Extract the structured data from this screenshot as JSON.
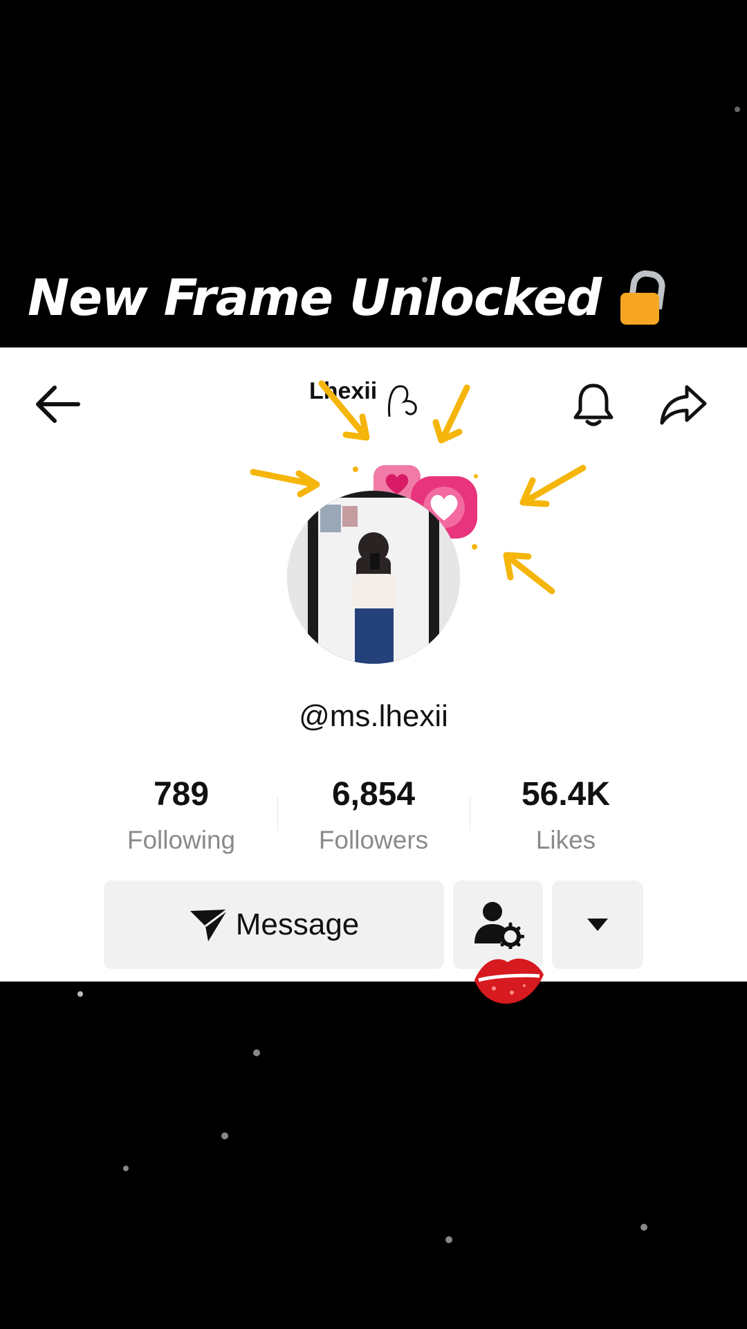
{
  "caption": {
    "text": "New Frame Unlocked"
  },
  "header": {
    "title": "Lhexii"
  },
  "profile": {
    "username": "@ms.lhexii"
  },
  "stats": [
    {
      "value": "789",
      "label": "Following"
    },
    {
      "value": "6,854",
      "label": "Followers"
    },
    {
      "value": "56.4K",
      "label": "Likes"
    }
  ],
  "actions": {
    "message_label": "Message"
  },
  "colors": {
    "background": "#000000",
    "card": "#ffffff",
    "button": "#f1f1f2",
    "accent_arrow": "#f5b50a",
    "heart_pink": "#e8347d",
    "lips_red": "#d61a1f"
  },
  "icons": [
    "back-arrow-icon",
    "bell-icon",
    "share-icon",
    "send-icon",
    "manage-account-icon",
    "dropdown-caret-icon",
    "lock-icon",
    "heart-icon",
    "lips-icon"
  ]
}
